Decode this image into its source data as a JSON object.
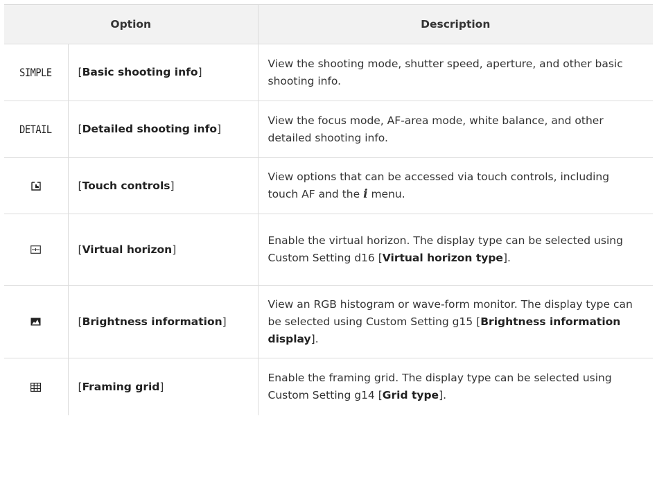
{
  "header": {
    "option": "Option",
    "description": "Description"
  },
  "rows": [
    {
      "icon": "SIMPLE",
      "icon_name": "simple-text-icon",
      "name": "Basic shooting info",
      "desc": "View the shooting mode, shutter speed, aperture, and other basic shooting info."
    },
    {
      "icon": "DETAIL",
      "icon_name": "detail-text-icon",
      "name": "Detailed shooting info",
      "desc": "View the focus mode, AF-area mode, white balance, and other detailed shooting info."
    },
    {
      "icon_name": "touch-controls-icon",
      "name": "Touch controls",
      "desc_a": "View options that can be accessed via touch controls, including touch AF and the ",
      "desc_i": "i",
      "desc_b": " menu."
    },
    {
      "icon_name": "virtual-horizon-icon",
      "name": "Virtual horizon",
      "desc_a": "Enable the virtual horizon. The display type can be selected using Custom Setting d16 [",
      "desc_bold": "Virtual horizon type",
      "desc_b": "]."
    },
    {
      "icon_name": "histogram-icon",
      "name": "Brightness information",
      "desc_a": "View an RGB histogram or wave-form monitor. The display type can be selected using Custom Setting g15 [",
      "desc_bold": "Brightness information display",
      "desc_b": "]."
    },
    {
      "icon_name": "framing-grid-icon",
      "name": "Framing grid",
      "desc_a": "Enable the framing grid. The display type can be selected using Custom Setting g14 [",
      "desc_bold": "Grid type",
      "desc_b": "]."
    }
  ]
}
